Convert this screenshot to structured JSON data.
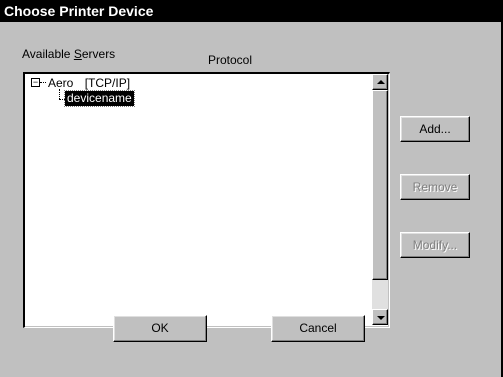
{
  "window": {
    "title": "Choose Printer Device"
  },
  "labels": {
    "servers_prefix": "Available ",
    "servers_mnemonic": "S",
    "servers_rest": "ervers",
    "protocol": "Protocol"
  },
  "tree": {
    "expander_glyph": "−",
    "server": {
      "name": "Aero",
      "protocol": "[TCP/IP]"
    },
    "device": {
      "name": "devicename",
      "selected": true
    }
  },
  "buttons": {
    "add": "Add...",
    "remove": "Remove",
    "modify": "Modify...",
    "ok": "OK",
    "cancel": "Cancel"
  }
}
